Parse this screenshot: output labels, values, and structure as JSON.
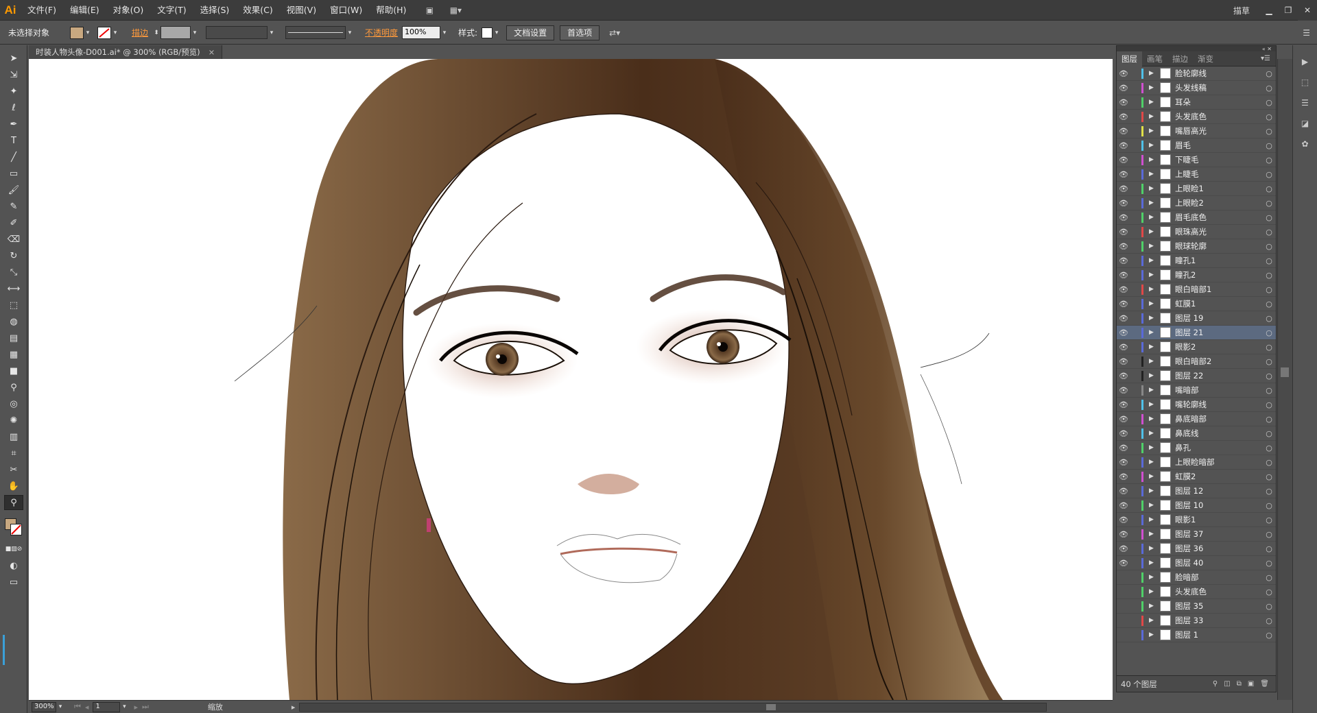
{
  "app": {
    "logo": "Ai"
  },
  "menu": {
    "items": [
      "文件(F)",
      "编辑(E)",
      "对象(O)",
      "文字(T)",
      "选择(S)",
      "效果(C)",
      "视图(V)",
      "窗口(W)",
      "帮助(H)"
    ],
    "workspace": "描草"
  },
  "control": {
    "selection_label": "未选择对象",
    "stroke_label": "描边",
    "opacity_label": "不透明度",
    "opacity_value": "100%",
    "style_label": "样式:",
    "doc_setup": "文档设置",
    "preferences": "首选项"
  },
  "document": {
    "tab_title": "时装人物头像-D001.ai* @ 300% (RGB/预览)",
    "close_glyph": "×"
  },
  "status": {
    "zoom": "300%",
    "page": "1",
    "mode": "缩放"
  },
  "layers_panel": {
    "tabs": [
      "图层",
      "画笔",
      "描边",
      "渐变"
    ],
    "count_label": "40 个图层",
    "layers": [
      {
        "name": "脸轮廓线",
        "color": "#4fc1e9",
        "visible": true
      },
      {
        "name": "头发线稿",
        "color": "#d04fd0",
        "visible": true
      },
      {
        "name": "耳朵",
        "color": "#4fd068",
        "visible": true
      },
      {
        "name": "头发底色",
        "color": "#e04848",
        "visible": true
      },
      {
        "name": "嘴唇高光",
        "color": "#e0e048",
        "visible": true
      },
      {
        "name": "眉毛",
        "color": "#4fc1e9",
        "visible": true
      },
      {
        "name": "下睫毛",
        "color": "#d04fd0",
        "visible": true
      },
      {
        "name": "上睫毛",
        "color": "#5a6ad8",
        "visible": true
      },
      {
        "name": "上眼睑1",
        "color": "#4fd068",
        "visible": true
      },
      {
        "name": "上眼睑2",
        "color": "#5a6ad8",
        "visible": true
      },
      {
        "name": "眉毛底色",
        "color": "#4fd068",
        "visible": true
      },
      {
        "name": "眼珠高光",
        "color": "#e04848",
        "visible": true
      },
      {
        "name": "眼球轮廓",
        "color": "#4fd068",
        "visible": true
      },
      {
        "name": "瞳孔1",
        "color": "#5a6ad8",
        "visible": true
      },
      {
        "name": "瞳孔2",
        "color": "#5a6ad8",
        "visible": true
      },
      {
        "name": "眼白暗部1",
        "color": "#e04848",
        "visible": true
      },
      {
        "name": "虹膜1",
        "color": "#5a6ad8",
        "visible": true
      },
      {
        "name": "图层 19",
        "color": "#5a6ad8",
        "visible": true
      },
      {
        "name": "图层 21",
        "color": "#5a6ad8",
        "visible": true,
        "selected": true
      },
      {
        "name": "眼影2",
        "color": "#5a6ad8",
        "visible": true
      },
      {
        "name": "眼白暗部2",
        "color": "#222222",
        "visible": true
      },
      {
        "name": "图层 22",
        "color": "#222222",
        "visible": true
      },
      {
        "name": "嘴暗部",
        "color": "#888888",
        "visible": true
      },
      {
        "name": "嘴轮廓线",
        "color": "#4fc1e9",
        "visible": true
      },
      {
        "name": "鼻底暗部",
        "color": "#d04fd0",
        "visible": true
      },
      {
        "name": "鼻底线",
        "color": "#4fc1e9",
        "visible": true
      },
      {
        "name": "鼻孔",
        "color": "#4fd068",
        "visible": true
      },
      {
        "name": "上眼睑暗部",
        "color": "#5a6ad8",
        "visible": true
      },
      {
        "name": "虹膜2",
        "color": "#d04fd0",
        "visible": true
      },
      {
        "name": "图层 12",
        "color": "#5a6ad8",
        "visible": true
      },
      {
        "name": "图层 10",
        "color": "#4fd068",
        "visible": true
      },
      {
        "name": "眼影1",
        "color": "#5a6ad8",
        "visible": true
      },
      {
        "name": "图层 37",
        "color": "#d04fd0",
        "visible": true
      },
      {
        "name": "图层 36",
        "color": "#5a6ad8",
        "visible": true
      },
      {
        "name": "图层 40",
        "color": "#5a6ad8",
        "visible": true
      },
      {
        "name": "脸暗部",
        "color": "#4fd068",
        "visible": false
      },
      {
        "name": "头发底色",
        "color": "#4fd068",
        "visible": false
      },
      {
        "name": "图层 35",
        "color": "#4fd068",
        "visible": false
      },
      {
        "name": "图层 33",
        "color": "#e04848",
        "visible": false
      },
      {
        "name": "图层 1",
        "color": "#5a6ad8",
        "visible": false
      }
    ]
  },
  "colors": {
    "accent_orange": "#ff9a00",
    "hair_brown": "#5a3a22",
    "skin": "#f6e4d8",
    "iris": "#7a5a3a"
  }
}
